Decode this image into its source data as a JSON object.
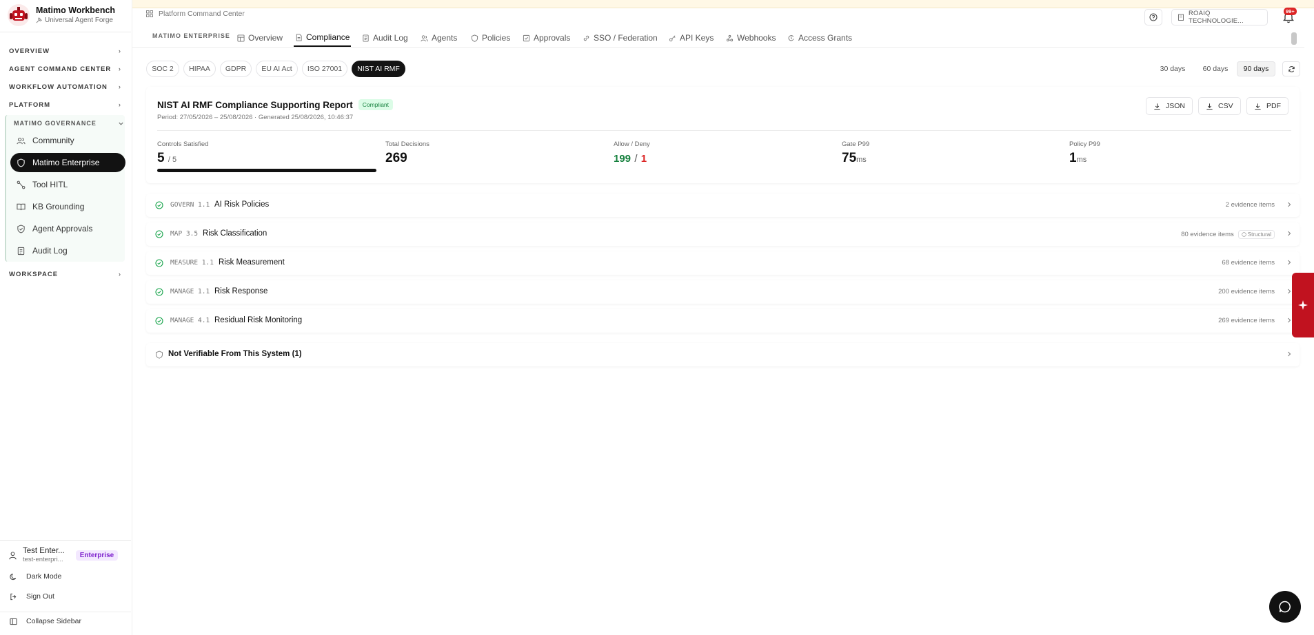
{
  "brand": {
    "title": "Matimo Workbench",
    "subtitle": "Universal Agent Forge"
  },
  "sidebar": {
    "sections": [
      {
        "label": "OVERVIEW"
      },
      {
        "label": "AGENT COMMAND CENTER"
      },
      {
        "label": "WORKFLOW AUTOMATION"
      },
      {
        "label": "PLATFORM"
      }
    ],
    "governance": {
      "label": "MATIMO GOVERNANCE",
      "items": [
        {
          "label": "Community",
          "icon": "users-icon"
        },
        {
          "label": "Matimo Enterprise",
          "icon": "shield-icon",
          "active": true
        },
        {
          "label": "Tool HITL",
          "icon": "route-icon"
        },
        {
          "label": "KB Grounding",
          "icon": "book-icon"
        },
        {
          "label": "Agent Approvals",
          "icon": "shield-check-icon"
        },
        {
          "label": "Audit Log",
          "icon": "scroll-icon"
        }
      ]
    },
    "workspace_label": "WORKSPACE",
    "user": {
      "name": "Test Enter...",
      "email": "test-enterpri...",
      "badge": "Enterprise"
    },
    "dark_mode": "Dark Mode",
    "sign_out": "Sign Out",
    "collapse": "Collapse Sidebar"
  },
  "topbar": {
    "breadcrumb": "Platform Command Center",
    "org": "ROAIQ TECHNOLOGIE...",
    "notif_count": "99+"
  },
  "tabs": {
    "prefix": "MATIMO ENTERPRISE",
    "items": [
      {
        "label": "Overview",
        "icon": "layout-icon"
      },
      {
        "label": "Compliance",
        "icon": "document-icon",
        "active": true
      },
      {
        "label": "Audit Log",
        "icon": "list-icon"
      },
      {
        "label": "Agents",
        "icon": "agents-icon"
      },
      {
        "label": "Policies",
        "icon": "shield-icon"
      },
      {
        "label": "Approvals",
        "icon": "check-square-icon"
      },
      {
        "label": "SSO / Federation",
        "icon": "link-icon"
      },
      {
        "label": "API Keys",
        "icon": "key-icon"
      },
      {
        "label": "Webhooks",
        "icon": "webhook-icon"
      },
      {
        "label": "Access Grants",
        "icon": "access-icon"
      }
    ]
  },
  "frameworks": [
    "SOC 2",
    "HIPAA",
    "GDPR",
    "EU AI Act",
    "ISO 27001",
    "NIST AI RMF"
  ],
  "active_framework": "NIST AI RMF",
  "ranges": [
    "30 days",
    "60 days",
    "90 days"
  ],
  "active_range": "90 days",
  "report": {
    "title": "NIST AI RMF Compliance Supporting Report",
    "status": "Compliant",
    "meta": "Period: 27/05/2026 – 25/08/2026 · Generated 25/08/2026, 10:46:37",
    "downloads": [
      "JSON",
      "CSV",
      "PDF"
    ],
    "metrics": {
      "controls": {
        "label": "Controls Satisfied",
        "value": "5",
        "total": "/ 5",
        "progress": 1.0
      },
      "decisions": {
        "label": "Total Decisions",
        "value": "269"
      },
      "allow_deny": {
        "label": "Allow / Deny",
        "allow": "199",
        "sep": "/",
        "deny": "1"
      },
      "gate": {
        "label": "Gate P99",
        "value": "75",
        "unit": "ms"
      },
      "policy": {
        "label": "Policy P99",
        "value": "1",
        "unit": "ms"
      }
    }
  },
  "controls": [
    {
      "code": "GOVERN 1.1",
      "name": "AI Risk Policies",
      "evidence": "2 evidence items",
      "tag": ""
    },
    {
      "code": "MAP 3.5",
      "name": "Risk Classification",
      "evidence": "80 evidence items",
      "tag": "Structural"
    },
    {
      "code": "MEASURE 1.1",
      "name": "Risk Measurement",
      "evidence": "68 evidence items",
      "tag": ""
    },
    {
      "code": "MANAGE 1.1",
      "name": "Risk Response",
      "evidence": "200 evidence items",
      "tag": ""
    },
    {
      "code": "MANAGE 4.1",
      "name": "Residual Risk Monitoring",
      "evidence": "269 evidence items",
      "tag": ""
    }
  ],
  "not_verifiable": "Not Verifiable From This System (1)",
  "colors": {
    "accent": "#121212",
    "allow": "#15803d",
    "deny": "#dc2626",
    "ai_tab": "#c1121f"
  }
}
